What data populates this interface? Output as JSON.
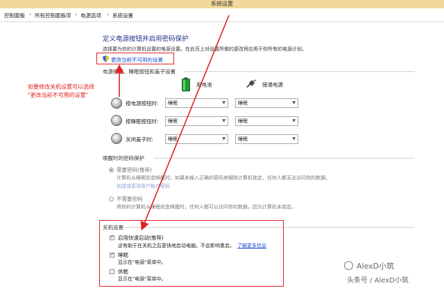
{
  "window": {
    "title": "系统设置"
  },
  "breadcrumb": [
    "控制面板",
    "所有控制面板项",
    "电源选项",
    "系统设置"
  ],
  "breadcrumb_separator": "›",
  "page": {
    "heading": "定义电源按钮并启用密码保护",
    "intro": "选择要为你的计算机设置的电源设置。在此页上对设置所做的更改将应用于你所有的电源计划。",
    "change_unavailable_link": "更改当前不可用的设置",
    "icons": {
      "shield": "uac-shield-icon",
      "battery": "battery-icon",
      "plug": "plug-icon",
      "row": "power-button-icon"
    }
  },
  "power_buttons": {
    "section_title": "电源按钮、睡眠按钮和盖子设置",
    "battery_label": "用电池",
    "plugged_label": "接通电源",
    "rows": [
      {
        "label": "按电源按钮时:",
        "battery": "睡眠",
        "plugged": "睡眠"
      },
      {
        "label": "按睡眠按钮时:",
        "battery": "睡眠",
        "plugged": "睡眠"
      },
      {
        "label": "关闭盖子时:",
        "battery": "睡眠",
        "plugged": "睡眠"
      }
    ]
  },
  "wake_password": {
    "section_title": "唤醒时的密码保护",
    "option1_title": "需要密码(推荐)",
    "option1_desc": "计算机从睡眠状态唤醒时，如果未输入正确的密码来解除计算机锁定，任何人都无法访问你的数据。",
    "option1_link": "创建或更改用户帐户密码",
    "option2_title": "不需要密码",
    "option2_desc": "将你的计算机从睡眠状态唤醒时，任何人都可以访问你的数据，因为计算机未锁定。"
  },
  "shutdown": {
    "section_title": "关机设置",
    "items": [
      {
        "label": "启用快速启动(推荐)",
        "desc": "这有助于在关机之后更快地启动电脑。不会影响重启。",
        "link": "了解更多信息",
        "checked": true
      },
      {
        "label": "睡眠",
        "desc": "显示在\"电源\"菜单中。",
        "checked": true
      },
      {
        "label": "休眠",
        "desc": "显示在\"电源\"菜单中。",
        "checked": false
      }
    ]
  },
  "annotation": {
    "text_line1": "如要修改关机设置可以选择",
    "text_line2": "\"更改当前不可用的设置\"",
    "color": "#e02020"
  },
  "watermark": {
    "line1": "AlexD小筑",
    "line2": "头条号 / AlexD小筑"
  }
}
